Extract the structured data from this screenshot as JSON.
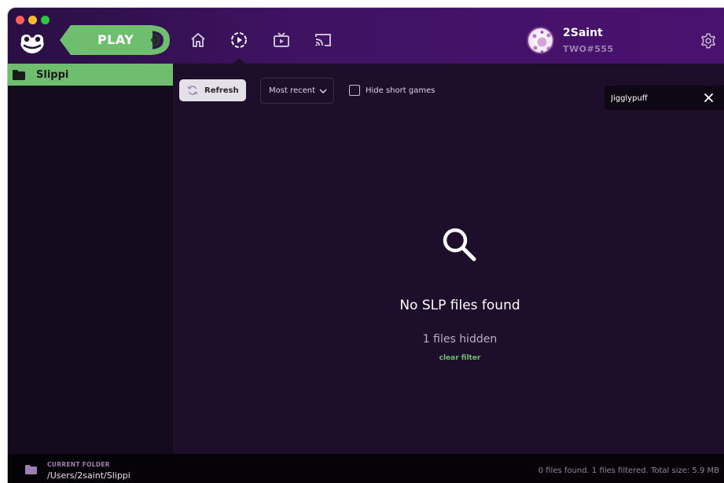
{
  "header": {
    "play_label": "PLAY",
    "nav": [
      {
        "icon": "home-icon"
      },
      {
        "icon": "replays-icon",
        "active": true
      },
      {
        "icon": "broadcast-tv-icon"
      },
      {
        "icon": "cast-icon"
      }
    ],
    "user": {
      "name": "2Saint",
      "code": "TWO#555"
    },
    "settings_icon": "gear-icon"
  },
  "sidebar": {
    "items": [
      {
        "label": "Slippi",
        "icon": "folder-icon",
        "selected": true
      }
    ]
  },
  "toolbar": {
    "refresh_label": "Refresh",
    "sort_value": "Most recent",
    "hide_short_label": "Hide short games",
    "hide_short_checked": false,
    "search_value": "Jigglypuff"
  },
  "empty_state": {
    "icon": "search-icon",
    "title": "No SLP files found",
    "hidden_text": "1 files hidden",
    "clear_filter_label": "clear filter"
  },
  "footer": {
    "caption": "CURRENT FOLDER",
    "path": "/Users/2saint/Slippi",
    "stats": "0 files found. 1 files filtered. Total size: 5.9 MB"
  },
  "colors": {
    "accent_green": "#6fbe6f",
    "header_purple": "#4a126f",
    "background": "#1d0f2b"
  }
}
